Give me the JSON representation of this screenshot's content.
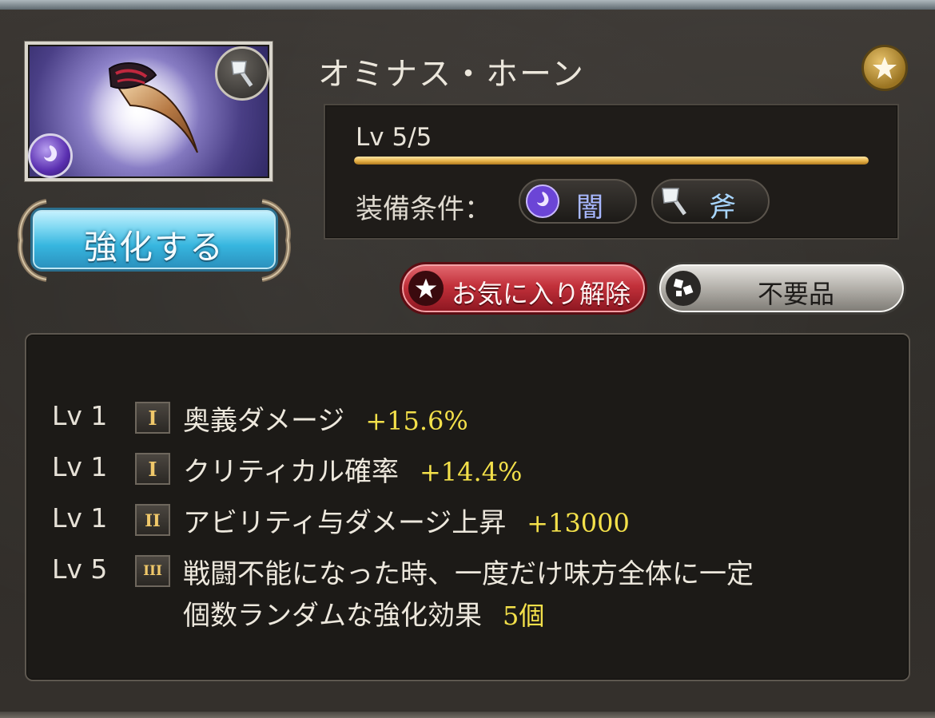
{
  "item": {
    "name": "オミナス・ホーン",
    "weapon_type_icon": "axe-icon",
    "element_icon": "dark-element-icon",
    "favorite_badge_icon": "star-icon"
  },
  "level": {
    "label": "Lv 5/5",
    "progress": 1.0
  },
  "equip": {
    "label": "装備条件：",
    "conditions": [
      {
        "icon": "dark-element-icon",
        "text": "闇"
      },
      {
        "icon": "axe-icon",
        "text": "斧"
      }
    ]
  },
  "buttons": {
    "upgrade": "強化する",
    "unfavorite": "お気に入り解除",
    "junk": "不要品"
  },
  "skills": [
    {
      "level": "Lv 1",
      "tier": "I",
      "name": "奥義ダメージ",
      "value": "+15.6%"
    },
    {
      "level": "Lv 1",
      "tier": "I",
      "name": "クリティカル確率",
      "value": "+14.4%"
    },
    {
      "level": "Lv 1",
      "tier": "II",
      "name": "アビリティ与ダメージ上昇",
      "value": "+13000"
    },
    {
      "level": "Lv 5",
      "tier": "III",
      "name_line1": "戦闘不能になった時、一度だけ味方全体に一定",
      "name_line2": "個数ランダムな強化効果",
      "value": "5個"
    }
  ],
  "colors": {
    "accent_gold": "#e7b249",
    "value_yellow": "#f3e04a",
    "button_blue": "#37b6df",
    "button_red": "#c2303a"
  }
}
